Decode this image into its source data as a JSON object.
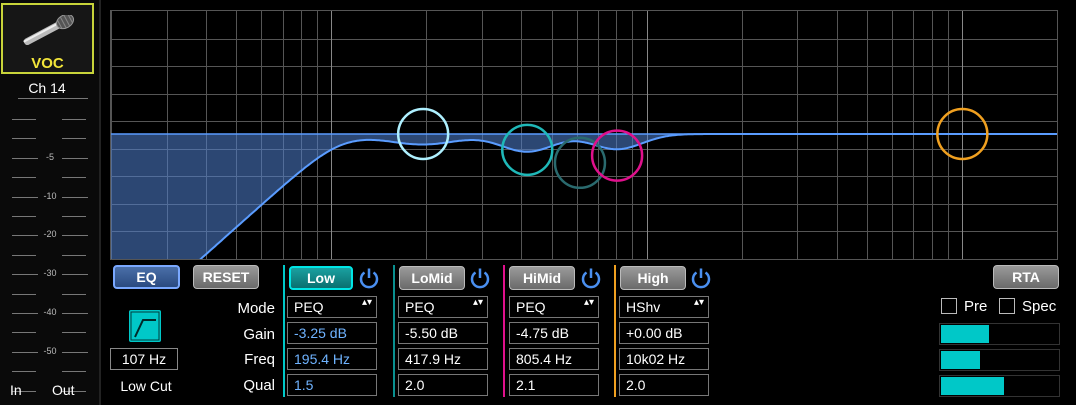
{
  "channel": {
    "name": "VOC",
    "number": "Ch 14",
    "meter_scale": [
      "-5",
      "-10",
      "-20",
      "-30",
      "-40",
      "-50"
    ],
    "meter_in_label": "In",
    "meter_out_label": "Out"
  },
  "controls": {
    "eq_label": "EQ",
    "reset_label": "RESET",
    "rta_label": "RTA",
    "row_labels": {
      "mode": "Mode",
      "gain": "Gain",
      "freq": "Freq",
      "qual": "Qual"
    },
    "low_cut": {
      "freq": "107 Hz",
      "label": "Low Cut"
    },
    "pre_label": "Pre",
    "spec_label": "Spec",
    "pre_checked": false,
    "spec_checked": false
  },
  "bands": [
    {
      "name": "Low",
      "mode": "PEQ",
      "gain": "-3.25 dB",
      "freq": "195.4 Hz",
      "q": "1.5",
      "color": "#00c8c8",
      "selected": true
    },
    {
      "name": "LoMid",
      "mode": "PEQ",
      "gain": "-5.50 dB",
      "freq": "417.9 Hz",
      "q": "2.0",
      "color": "#00b0b0",
      "selected": false
    },
    {
      "name": "HiMid",
      "mode": "PEQ",
      "gain": "-4.75 dB",
      "freq": "805.4 Hz",
      "q": "2.1",
      "color": "#e0108c",
      "selected": false
    },
    {
      "name": "High",
      "mode": "HShv",
      "gain": "+0.00 dB",
      "freq": "10k02 Hz",
      "q": "2.0",
      "color": "#f0a020",
      "selected": false
    }
  ],
  "rta_meters": [
    0.4,
    0.33,
    0.53
  ],
  "colors": {
    "accent_cyan": "#00c8c8",
    "eq_curve": "#5a9cff",
    "low_handle": "#aef0ff",
    "lomid_handle": "#1fb8b8",
    "himid_ghost_handle": "#2a6a6e",
    "himid_handle": "#e0108c",
    "high_handle": "#f0a020"
  }
}
